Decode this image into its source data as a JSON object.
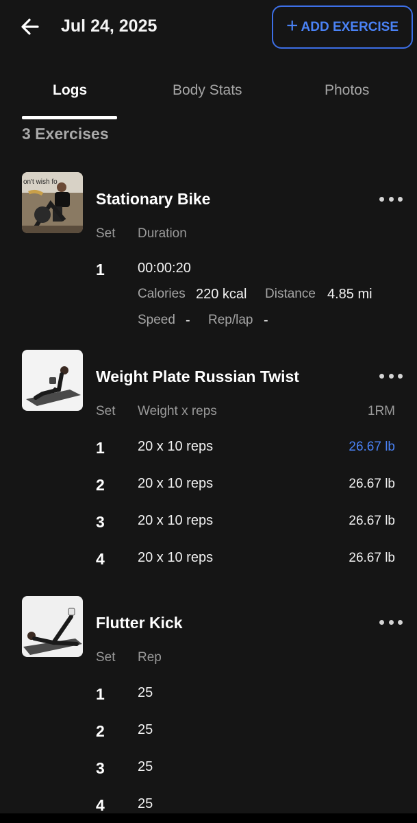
{
  "header": {
    "back_icon": "arrow-left-icon",
    "date": "Jul 24, 2025",
    "add_button": {
      "icon": "plus-icon",
      "label": "ADD EXERCISE",
      "color": "#4a82f5"
    }
  },
  "tabs": [
    {
      "label": "Logs",
      "active": true
    },
    {
      "label": "Body Stats",
      "active": false
    },
    {
      "label": "Photos",
      "active": false
    }
  ],
  "exercise_count": "3 Exercises",
  "exercises": [
    {
      "name": "Stationary Bike",
      "thumbnail_text": "on't wish fo",
      "columns": {
        "set": "Set",
        "main": "Duration"
      },
      "sets": [
        {
          "set": "1",
          "duration": "00:00:20",
          "calories_label": "Calories",
          "calories": "220 kcal",
          "distance_label": "Distance",
          "distance": "4.85 mi",
          "speed_label": "Speed",
          "speed": "-",
          "replap_label": "Rep/lap",
          "replap": "-"
        }
      ]
    },
    {
      "name": "Weight Plate Russian Twist",
      "columns": {
        "set": "Set",
        "main": "Weight x reps",
        "extra": "1RM"
      },
      "sets": [
        {
          "set": "1",
          "value": "20 x 10 reps",
          "rm": "26.67 lb",
          "best": true
        },
        {
          "set": "2",
          "value": "20 x 10 reps",
          "rm": "26.67 lb",
          "best": false
        },
        {
          "set": "3",
          "value": "20 x 10 reps",
          "rm": "26.67 lb",
          "best": false
        },
        {
          "set": "4",
          "value": "20 x 10 reps",
          "rm": "26.67 lb",
          "best": false
        }
      ]
    },
    {
      "name": "Flutter Kick",
      "columns": {
        "set": "Set",
        "main": "Rep"
      },
      "sets": [
        {
          "set": "1",
          "value": "25"
        },
        {
          "set": "2",
          "value": "25"
        },
        {
          "set": "3",
          "value": "25"
        },
        {
          "set": "4",
          "value": "25"
        }
      ]
    }
  ],
  "colors": {
    "background": "#151515",
    "accent": "#4a82f5",
    "muted": "#a6a6a6"
  }
}
